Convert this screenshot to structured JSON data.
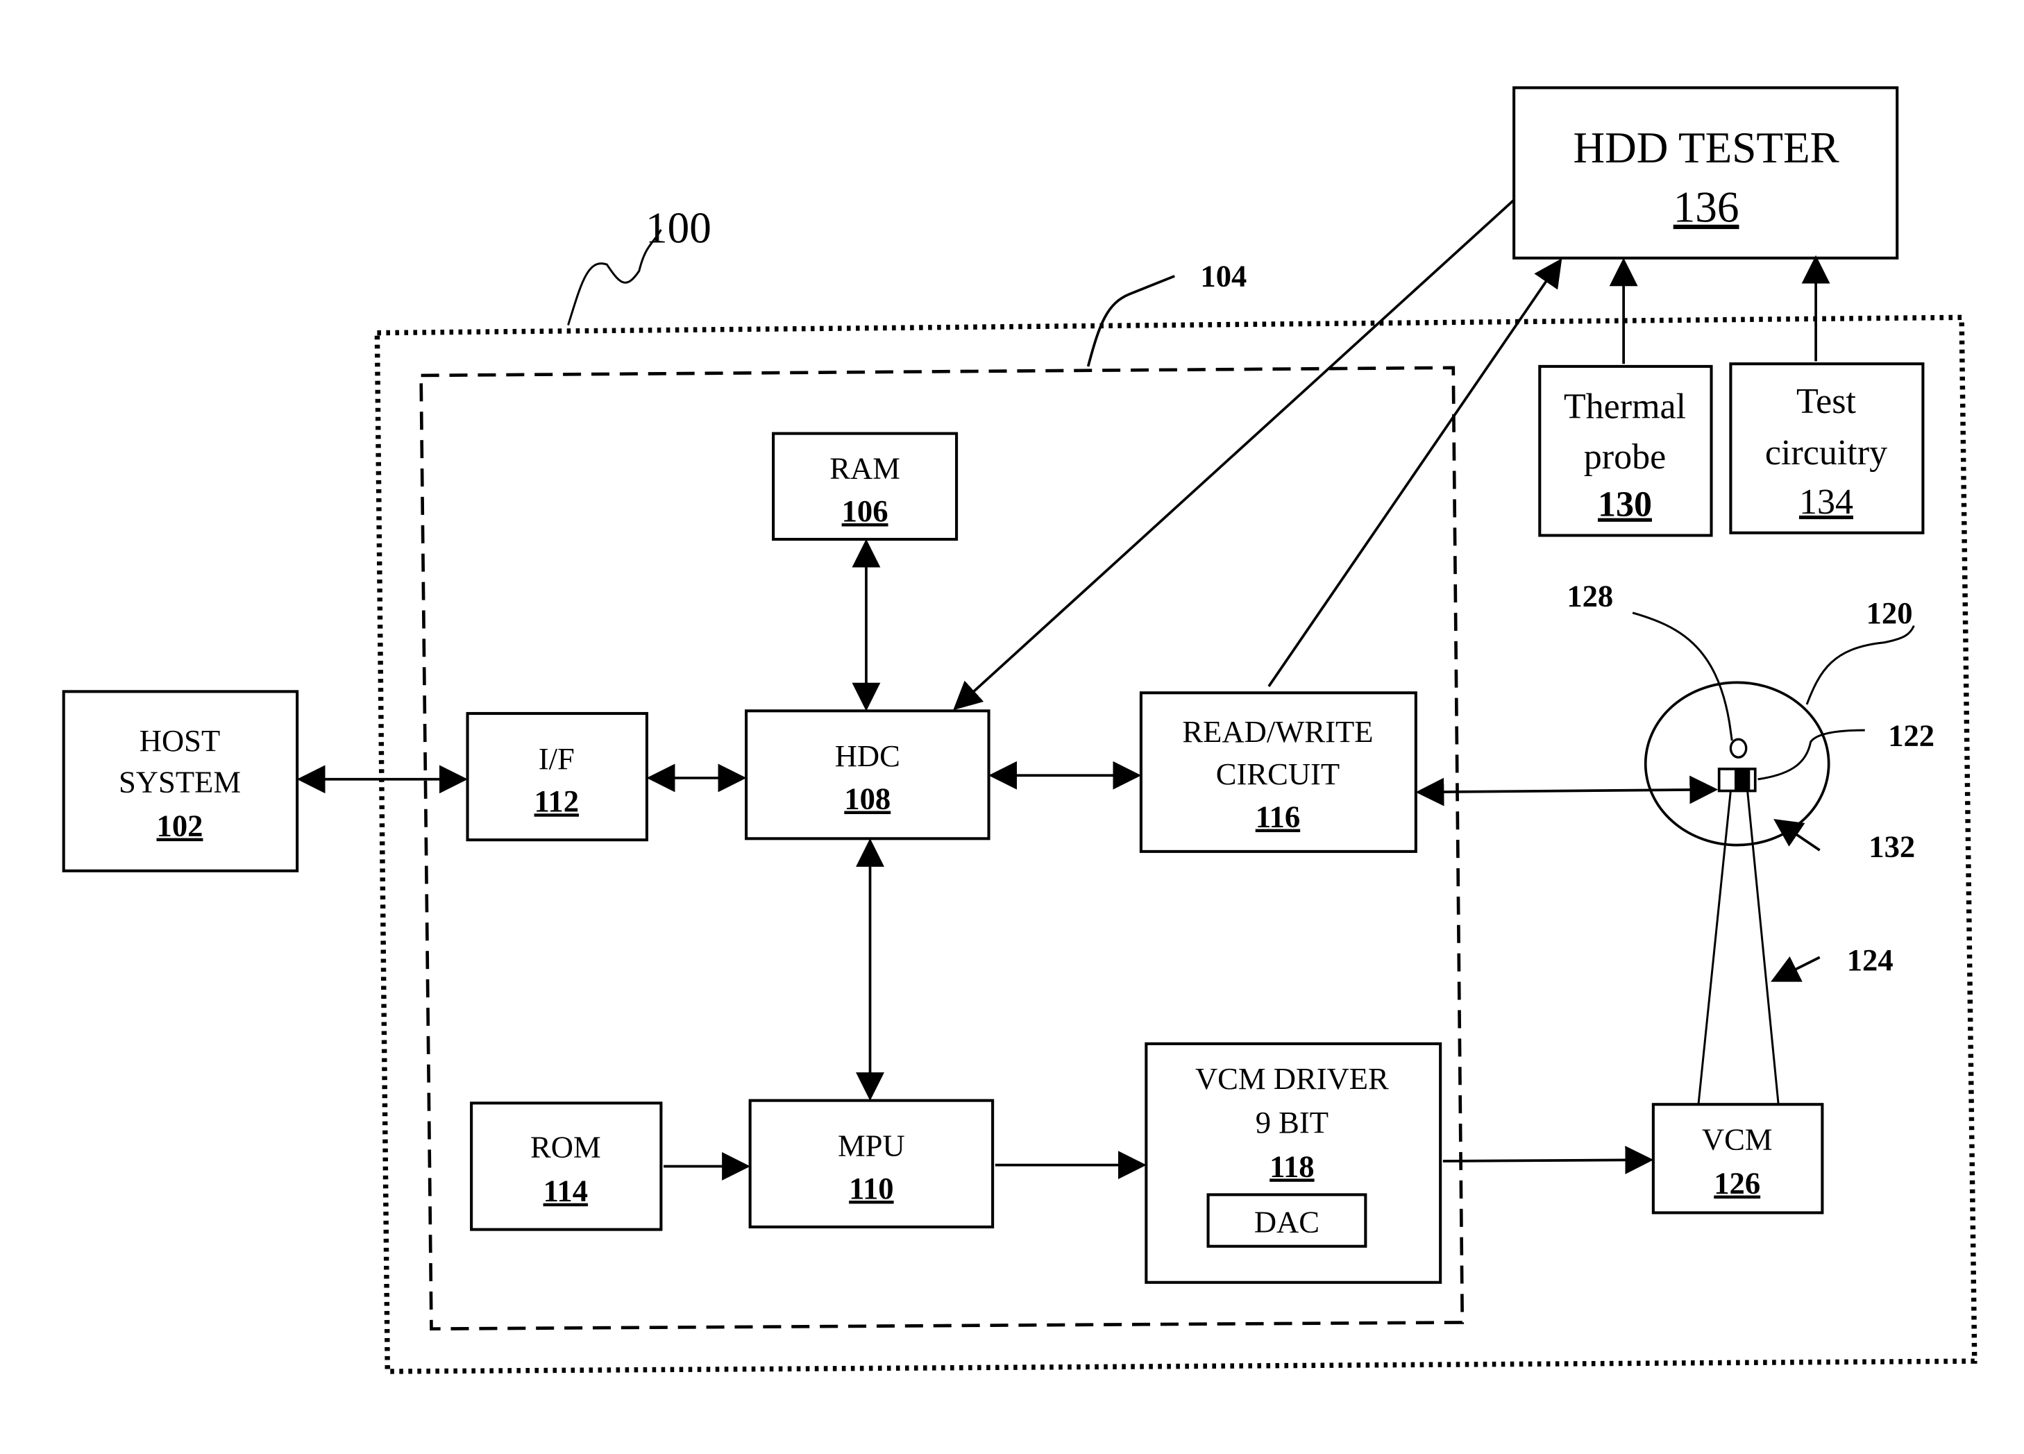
{
  "figure": {
    "system_label": "100",
    "controller_label": "104",
    "blocks": {
      "host": {
        "line1": "HOST",
        "line2": "SYSTEM",
        "ref": "102"
      },
      "interface": {
        "line1": "I/F",
        "ref": "112"
      },
      "hdc": {
        "line1": "HDC",
        "ref": "108"
      },
      "ram": {
        "line1": "RAM",
        "ref": "106"
      },
      "rw": {
        "line1": "READ/WRITE",
        "line2": "CIRCUIT",
        "ref": "116"
      },
      "rom": {
        "line1": "ROM",
        "ref": "114"
      },
      "mpu": {
        "line1": "MPU",
        "ref": "110"
      },
      "vcm_driver": {
        "line1": "VCM DRIVER",
        "line2": "9 BIT",
        "ref": "118",
        "sub": "DAC"
      },
      "vcm": {
        "line1": "VCM",
        "ref": "126"
      },
      "tester": {
        "line1": "HDD TESTER",
        "ref": "136"
      },
      "thermal": {
        "line1": "Thermal",
        "line2": "probe",
        "ref": "130"
      },
      "test_circ": {
        "line1": "Test",
        "line2": "circuitry",
        "ref": "134"
      }
    },
    "callouts": {
      "disk": "120",
      "head": "122",
      "arm": "124",
      "spindle": "128",
      "sensor": "132"
    }
  }
}
